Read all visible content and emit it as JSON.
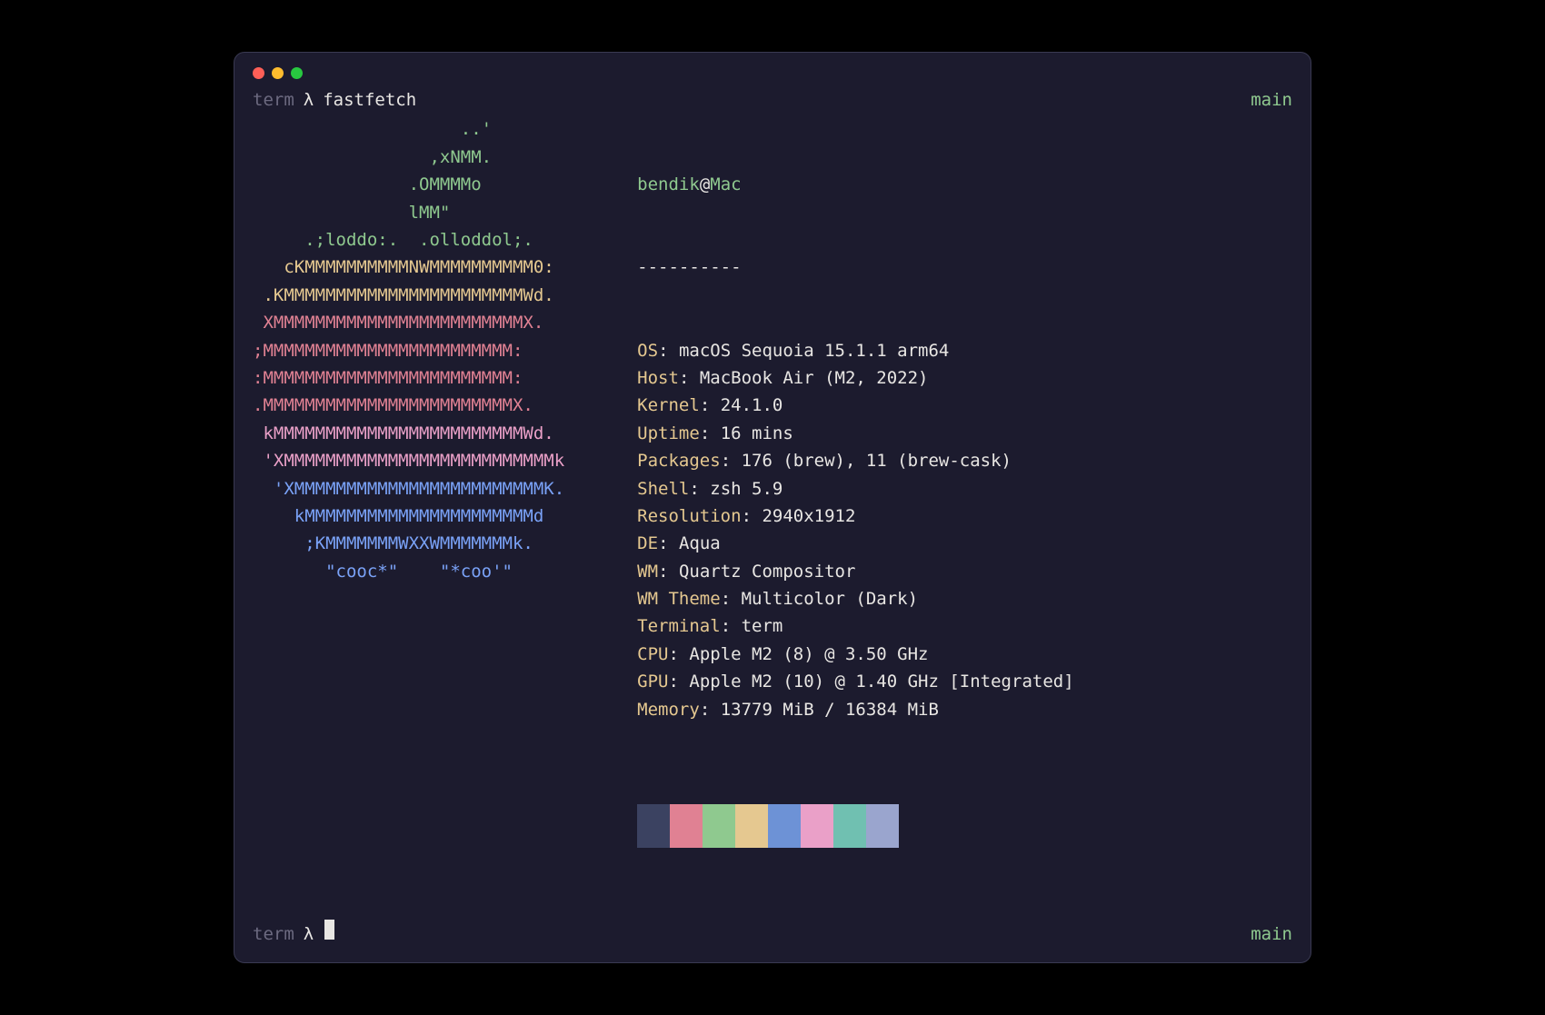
{
  "prompt": {
    "term": "term",
    "lambda": "λ",
    "cmd": "fastfetch",
    "branch": "main"
  },
  "ascii": {
    "lines": [
      {
        "color": "c-green",
        "text": "                    ..'"
      },
      {
        "color": "c-green",
        "text": "                 ,xNMM."
      },
      {
        "color": "c-green",
        "text": "               .OMMMMo"
      },
      {
        "color": "c-green",
        "text": "               lMM\""
      },
      {
        "color": "c-green",
        "text": "     .;loddo:.  .olloddol;."
      },
      {
        "color": "c-yellow",
        "text": "   cKMMMMMMMMMMNWMMMMMMMMMM0:"
      },
      {
        "color": "c-yellow",
        "text": " .KMMMMMMMMMMMMMMMMMMMMMMMWd."
      },
      {
        "color": "c-red",
        "text": " XMMMMMMMMMMMMMMMMMMMMMMMMX."
      },
      {
        "color": "c-red",
        "text": ";MMMMMMMMMMMMMMMMMMMMMMMM:"
      },
      {
        "color": "c-red",
        "text": ":MMMMMMMMMMMMMMMMMMMMMMMM:"
      },
      {
        "color": "c-red",
        "text": ".MMMMMMMMMMMMMMMMMMMMMMMMX."
      },
      {
        "color": "c-pink",
        "text": " kMMMMMMMMMMMMMMMMMMMMMMMMWd."
      },
      {
        "color": "c-pink",
        "text": " 'XMMMMMMMMMMMMMMMMMMMMMMMMMMk"
      },
      {
        "color": "c-blue",
        "text": "  'XMMMMMMMMMMMMMMMMMMMMMMMMK."
      },
      {
        "color": "c-blue",
        "text": "    kMMMMMMMMMMMMMMMMMMMMMMd"
      },
      {
        "color": "c-blue",
        "text": "     ;KMMMMMMMWXXWMMMMMMMk."
      },
      {
        "color": "c-blue",
        "text": "       \"cooc*\"    \"*coo'\""
      }
    ]
  },
  "info": {
    "user": "bendik",
    "at": "@",
    "host": "Mac",
    "sep": "----------",
    "rows": [
      {
        "key": "OS",
        "val": "macOS Sequoia 15.1.1 arm64"
      },
      {
        "key": "Host",
        "val": "MacBook Air (M2, 2022)"
      },
      {
        "key": "Kernel",
        "val": "24.1.0"
      },
      {
        "key": "Uptime",
        "val": "16 mins"
      },
      {
        "key": "Packages",
        "val": "176 (brew), 11 (brew-cask)"
      },
      {
        "key": "Shell",
        "val": "zsh 5.9"
      },
      {
        "key": "Resolution",
        "val": "2940x1912"
      },
      {
        "key": "DE",
        "val": "Aqua"
      },
      {
        "key": "WM",
        "val": "Quartz Compositor"
      },
      {
        "key": "WM Theme",
        "val": "Multicolor (Dark)"
      },
      {
        "key": "Terminal",
        "val": "term"
      },
      {
        "key": "CPU",
        "val": "Apple M2 (8) @ 3.50 GHz"
      },
      {
        "key": "GPU",
        "val": "Apple M2 (10) @ 1.40 GHz [Integrated]"
      },
      {
        "key": "Memory",
        "val": "13779 MiB / 16384 MiB"
      }
    ]
  },
  "palette": [
    "#3b4261",
    "#e08193",
    "#8fc98f",
    "#e5c890",
    "#6d92d6",
    "#eaa0c8",
    "#70c0b1",
    "#9aa5ce"
  ]
}
